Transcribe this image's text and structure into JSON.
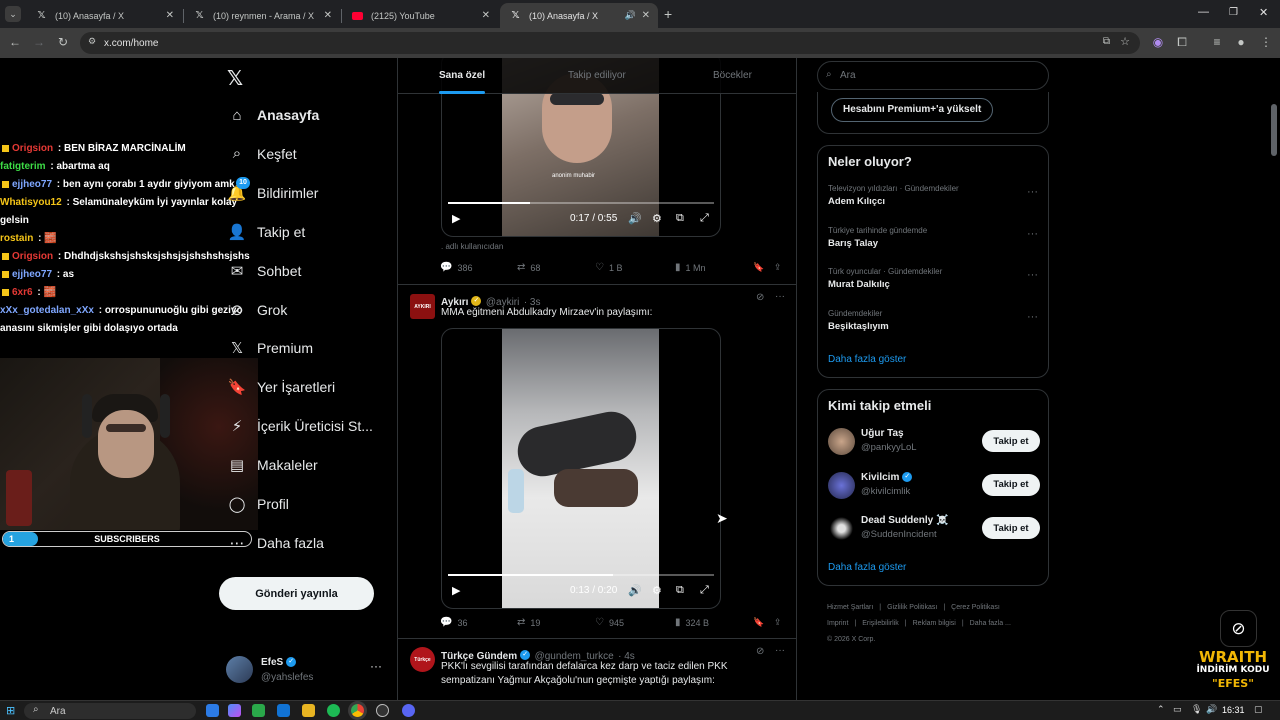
{
  "browser": {
    "tabs": [
      {
        "title": "(10) Anasayfa / X",
        "icon": "x-logo-icon",
        "active": false
      },
      {
        "title": "(10) reynmen - Arama / X",
        "icon": "x-logo-icon",
        "active": false
      },
      {
        "title": "(2125) YouTube",
        "icon": "youtube-icon",
        "active": false
      },
      {
        "title": "(10) Anasayfa / X",
        "icon": "x-logo-icon",
        "active": true
      }
    ],
    "url": "x.com/home"
  },
  "stream_overlay": {
    "chat": [
      {
        "user": "Origsion",
        "user_color": "#e53935",
        "badge": true,
        "text": "BEN BİRAZ MARCİNALİM"
      },
      {
        "user": "fatigterim",
        "user_color": "#3ddc46",
        "badge": false,
        "text": "abartma aq"
      },
      {
        "user": "ejjheo77",
        "user_color": "#7fa7ff",
        "badge": true,
        "text": "ben aynı çorabı 1 aydır giyiyom amk"
      },
      {
        "user": "Whatisyou12",
        "user_color": "#f5c518",
        "badge": false,
        "text": "Selamünaleyküm İyi yayınlar kolay gelsin"
      },
      {
        "user": "rostain",
        "user_color": "#f5c518",
        "badge": false,
        "text": "🧱"
      },
      {
        "user": "Origsion",
        "user_color": "#e53935",
        "badge": true,
        "text": "Dhdhdjskshsjshsksjshsjsjshshshsjshs"
      },
      {
        "user": "ejjheo77",
        "user_color": "#7fa7ff",
        "badge": true,
        "text": "as"
      },
      {
        "user": "6xr6",
        "user_color": "#e53935",
        "badge": true,
        "text": "🧱"
      },
      {
        "user": "xXx_gotedalan_xXx",
        "user_color": "#7fa7ff",
        "badge": false,
        "text": "orrospununuoğlu gibi geziyo anasını sikmişler gibi dolaşıyo ortada"
      }
    ],
    "subscribers_label": "SUBSCRIBERS",
    "subscribers_count": "1",
    "subscribers_progress": 0.14,
    "wraith_line1": "WRAITH",
    "wraith_line2": "İNDİRİM KODU",
    "wraith_line3": "\"EFES\""
  },
  "sidebar": {
    "nav": [
      {
        "label": "Anasayfa",
        "icon": "home-icon",
        "active": true
      },
      {
        "label": "Keşfet",
        "icon": "search-icon",
        "active": false
      },
      {
        "label": "Bildirimler",
        "icon": "bell-icon",
        "active": false,
        "badge": "10"
      },
      {
        "label": "Takip et",
        "icon": "add-person-icon",
        "active": false
      },
      {
        "label": "Sohbet",
        "icon": "mail-icon",
        "active": false
      },
      {
        "label": "Grok",
        "icon": "grok-icon",
        "active": false
      },
      {
        "label": "Premium",
        "icon": "x-logo-icon",
        "active": false
      },
      {
        "label": "Yer İşaretleri",
        "icon": "bookmark-icon",
        "active": false
      },
      {
        "label": "İçerik Üreticisi St...",
        "icon": "lightning-icon",
        "active": false
      },
      {
        "label": "Makaleler",
        "icon": "article-icon",
        "active": false
      },
      {
        "label": "Profil",
        "icon": "person-icon",
        "active": false
      },
      {
        "label": "Daha fazla",
        "icon": "more-circle-icon",
        "active": false
      }
    ],
    "post_button": "Gönderi yayınla",
    "account": {
      "name": "EfeS",
      "handle": "@yahslefes"
    }
  },
  "feed": {
    "tabs": [
      "Sana özel",
      "Takip ediliyor",
      "Böcekler"
    ],
    "posts": [
      {
        "video_watermark": "anonim muhabir",
        "video_time": "0:17 / 0:55",
        "video_progress": 0.31,
        "caption": ". adlı kullanıcıdan",
        "replies": "386",
        "reposts": "68",
        "likes": "1 B",
        "views": "1 Mn"
      },
      {
        "name": "Aykırı",
        "handle": "@aykiri",
        "time": "· 3s",
        "avatar_text": "AYKIRI",
        "text": "MMA eğitmeni Abdulkadry Mirzaev'in paylaşımı:",
        "video_time": "0:13 / 0:20",
        "video_progress": 0.62,
        "replies": "36",
        "reposts": "19",
        "likes": "945",
        "views": "324 B"
      },
      {
        "name": "Türkçe Gündem",
        "handle": "@gundem_turkce",
        "time": "· 4s",
        "avatar_text": "Türkçe",
        "text_line1": "PKK'lı sevgilisi tarafından defalarca kez darp ve taciz edilen PKK",
        "text_line2": "sempatizanı Yağmur Akçağolu'nun geçmişte yaptığı paylaşım:"
      }
    ]
  },
  "right": {
    "search_placeholder": "Ara",
    "premium_button": "Hesabını Premium+'a yükselt",
    "trends_title": "Neler oluyor?",
    "trends": [
      {
        "meta": "Televizyon yıldızları · Gündemdekiler",
        "name": "Adem Kılıçcı"
      },
      {
        "meta": "Türkiye tarihinde gündemde",
        "name": "Barış Talay"
      },
      {
        "meta": "Türk oyuncular · Gündemdekiler",
        "name": "Murat Dalkılıç"
      },
      {
        "meta": "Gündemdekiler",
        "name": "Beşiktaşlıyım"
      }
    ],
    "trends_more": "Daha fazla göster",
    "follow_title": "Kimi takip etmeli",
    "follow": [
      {
        "name": "Uğur Taş",
        "handle": "@pankyyLoL",
        "verified": false,
        "button": "Takip et"
      },
      {
        "name": "Kivilcim",
        "handle": "@kivilcimlik",
        "verified": true,
        "button": "Takip et"
      },
      {
        "name": "Dead Suddenly ☠️",
        "handle": "@SuddenIncident",
        "verified": false,
        "button": "Takip et"
      }
    ],
    "follow_more": "Daha fazla göster",
    "footer": {
      "links1": [
        "Hizmet Şartları",
        "Gizlilik Politikası",
        "Çerez Politikası"
      ],
      "links2": [
        "Imprint",
        "Erişilebilirlik",
        "Reklam bilgisi",
        "Daha fazla ..."
      ],
      "copyright": "© 2026 X Corp."
    }
  },
  "taskbar": {
    "search": "Ara",
    "time": "16:31"
  },
  "colors": {
    "accent": "#1d9bf0",
    "background": "#000000",
    "border": "#2f3336",
    "muted": "#71767b"
  }
}
